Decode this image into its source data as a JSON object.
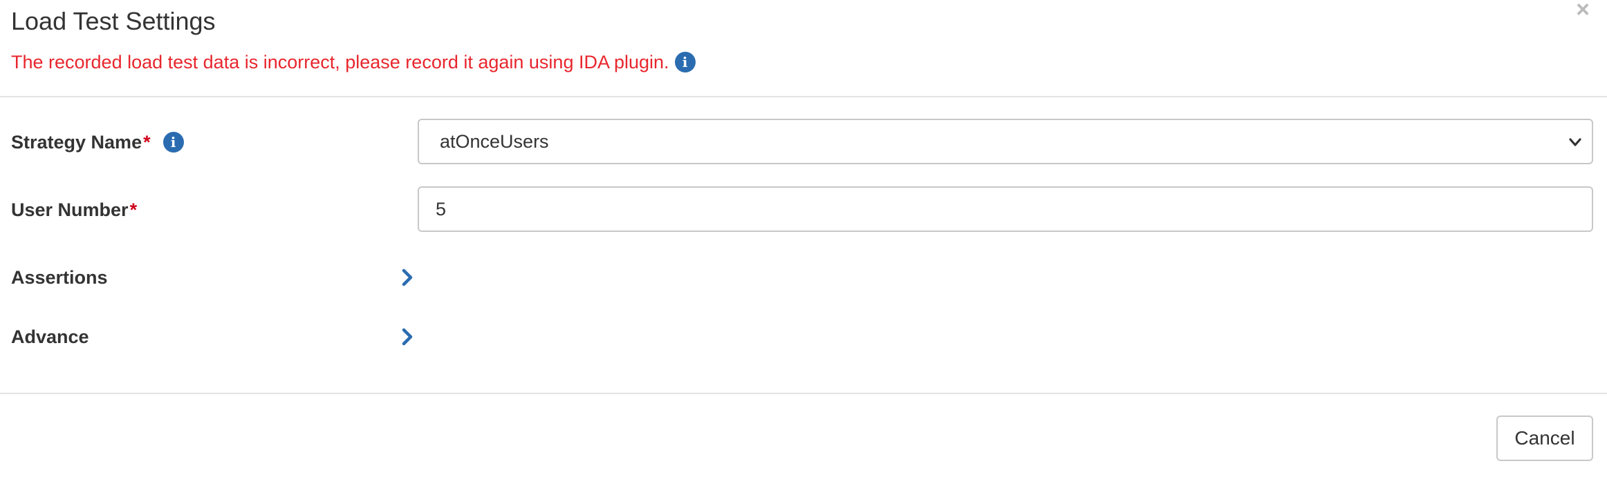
{
  "header": {
    "title": "Load Test Settings",
    "close_label": "×",
    "error_message": "The recorded load test data is incorrect, please record it again using IDA plugin."
  },
  "form": {
    "strategy": {
      "label": "Strategy Name",
      "required_mark": "*",
      "selected_value": "atOnceUsers"
    },
    "user_number": {
      "label": "User Number",
      "required_mark": "*",
      "value": "5"
    },
    "assertions": {
      "label": "Assertions"
    },
    "advance": {
      "label": "Advance"
    }
  },
  "footer": {
    "cancel_label": "Cancel"
  },
  "icons": {
    "info": "info-circle-icon",
    "expand": "chevron-right-icon",
    "select": "chevron-down-icon",
    "close": "close-icon"
  },
  "colors": {
    "error": "#e8262d",
    "accent": "#2b6cb0",
    "required": "#d0021b"
  }
}
